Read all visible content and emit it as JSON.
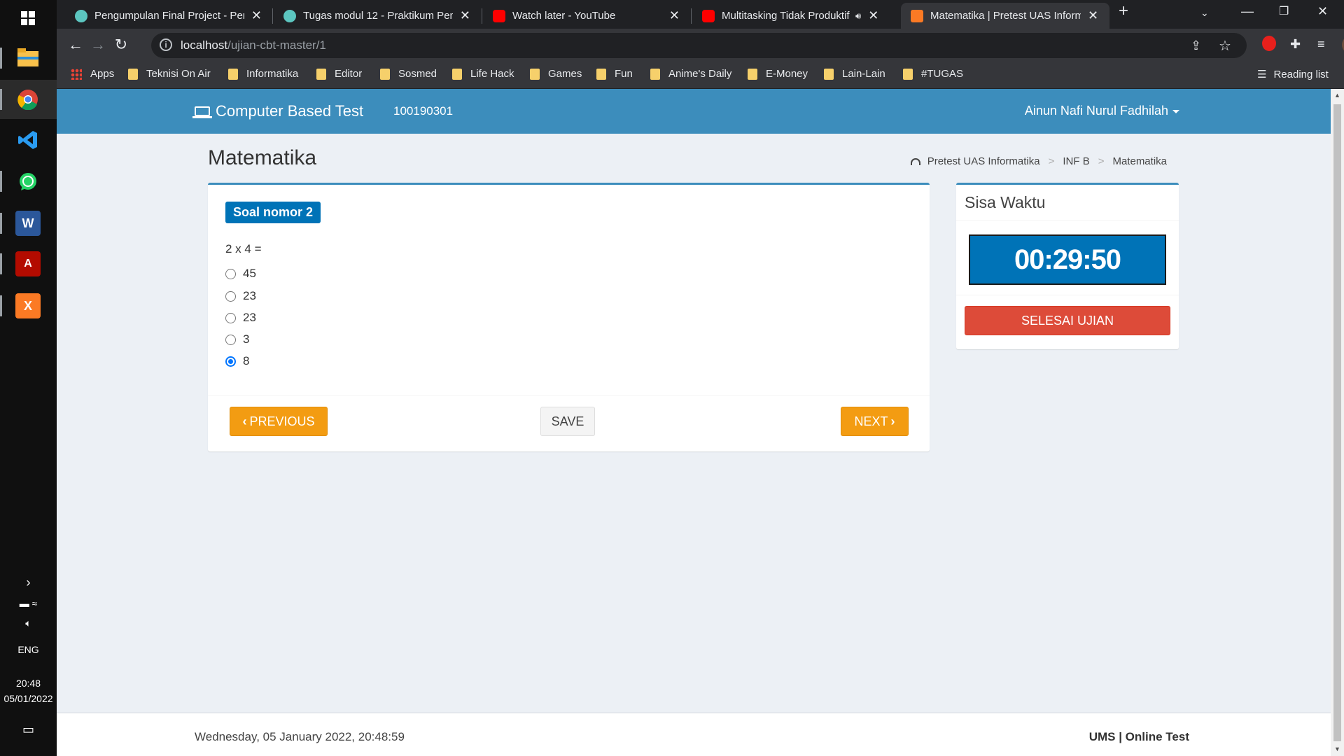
{
  "taskbar": {
    "time": "20:48",
    "date": "05/01/2022",
    "language": "ENG",
    "apps": [
      "file-explorer-icon",
      "chrome-icon",
      "vscode-icon",
      "whatsapp-icon",
      "word-icon",
      "acrobat-icon",
      "xampp-icon"
    ]
  },
  "browser": {
    "tabs": [
      {
        "title": "Pengumpulan Final Project - Pem",
        "active": false
      },
      {
        "title": "Tugas modul 12 - Praktikum Pem",
        "active": false
      },
      {
        "title": "Watch later - YouTube",
        "active": false
      },
      {
        "title": "Multitasking Tidak Produktif",
        "active": false
      },
      {
        "title": "Matematika | Pretest UAS Inform",
        "active": true
      }
    ],
    "url_host": "localhost",
    "url_path": "/ujian-cbt-master/1",
    "bookmarks": [
      "Apps",
      "Teknisi On Air",
      "Informatika",
      "Editor",
      "Sosmed",
      "Life Hack",
      "Games",
      "Fun",
      "Anime's Daily",
      "E-Money",
      "Lain-Lain",
      "#TUGAS"
    ],
    "reading_list": "Reading list"
  },
  "header": {
    "brand": "Computer Based Test",
    "user_id": "100190301",
    "user_name": "Ainun Nafi Nurul Fadhilah"
  },
  "content": {
    "title": "Matematika",
    "breadcrumb": [
      "Pretest UAS Informatika",
      "INF B",
      "Matematika"
    ]
  },
  "question": {
    "label": "Soal nomor 2",
    "text": "2 x 4 =",
    "options": [
      "45",
      "23",
      "23",
      "3",
      "8"
    ],
    "selected_index": 4
  },
  "buttons": {
    "previous": "PREVIOUS",
    "save": "SAVE",
    "next": "NEXT"
  },
  "timer": {
    "title": "Sisa Waktu",
    "value": "00:29:50",
    "finish": "SELESAI UJIAN"
  },
  "footer": {
    "datetime": "Wednesday, 05 January 2022, 20:48:59",
    "brand": "UMS | Online Test"
  },
  "colors": {
    "header": "#3c8dbc",
    "label": "#0073b7",
    "warning": "#f39c12",
    "danger": "#dd4b39"
  }
}
